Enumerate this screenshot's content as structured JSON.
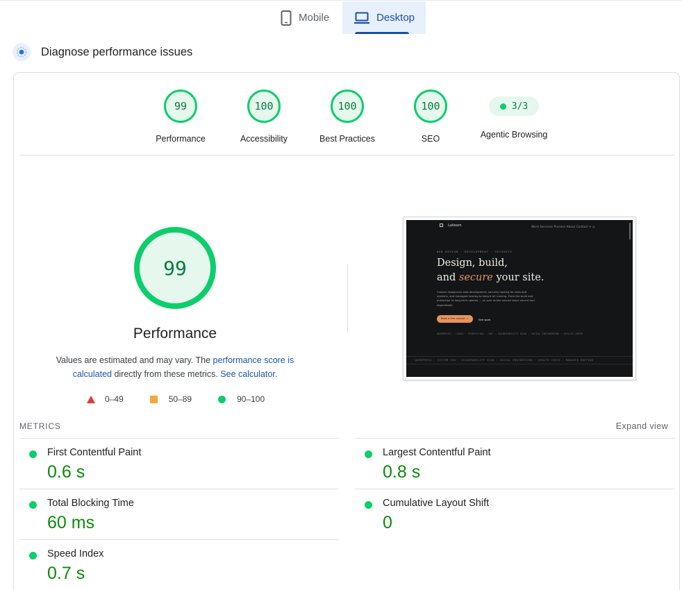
{
  "tabs": [
    {
      "label": "Mobile",
      "icon": "phone-icon",
      "selected": false
    },
    {
      "label": "Desktop",
      "icon": "laptop-icon",
      "selected": true
    }
  ],
  "section": {
    "title": "Diagnose performance issues",
    "icon": "diagnose-icon"
  },
  "categories": [
    {
      "score": "99",
      "label": "Performance"
    },
    {
      "score": "100",
      "label": "Accessibility"
    },
    {
      "score": "100",
      "label": "Best Practices"
    },
    {
      "score": "100",
      "label": "SEO"
    },
    {
      "score": "3/3",
      "label": "Agentic Browsing"
    }
  ],
  "performance": {
    "score": "99",
    "label": "Performance",
    "note_prefix": "Values are estimated and may vary. The ",
    "note_link1": "performance score is calculated",
    "note_middle": " directly from these metrics. ",
    "note_link2": "See calculator",
    "note_suffix": "."
  },
  "legend": [
    {
      "range": "0–49",
      "color": "#e53935",
      "shape": "triangle"
    },
    {
      "range": "50–89",
      "color": "#f4a93a",
      "shape": "square"
    },
    {
      "range": "90–100",
      "color": "#0cce6b",
      "shape": "circle"
    }
  ],
  "screenshot": {
    "brand": "Laileam",
    "nav": "Work   Services   Process   About   Contact   ✦   ◎",
    "eyebrow": "WEB DESIGN · DEVELOPMENT · SECURITY",
    "headline_line1": "Design, build,",
    "headline_and": "and ",
    "headline_accent": "secure",
    "headline_rest": " your site.",
    "body": "Custom responsive web development, security hosting for sites and systems, and managed hosting to keep it all running. From the build and protection to long-term upkeep — so your online service stays secure and dependable.",
    "cta": "Book a free consult  →",
    "secondary": "See work",
    "tags": "WORDPRESS  ·  LINUX  ·  PENTESTING  ·  WAF  ·  VULNERABILITY SCAN  ·  SOCIAL ENGINEERING  ·  HEALTH CHECK",
    "ticker": "·  WORDPRESS  ·  SYSTEM SEO  ·  VULNERABILITY SCAN  ·  SOCIAL ENGINEERING  ·  HEALTH CHECK  ·  MANAGED HOSTING"
  },
  "metrics": {
    "heading": "METRICS",
    "expand_label": "Expand view",
    "items": [
      {
        "name": "First Contentful Paint",
        "value": "0.6 s"
      },
      {
        "name": "Largest Contentful Paint",
        "value": "0.8 s"
      },
      {
        "name": "Total Blocking Time",
        "value": "60 ms"
      },
      {
        "name": "Cumulative Layout Shift",
        "value": "0"
      },
      {
        "name": "Speed Index",
        "value": "0.7 s"
      }
    ]
  },
  "colors": {
    "pass": "#0cce6b",
    "pass_text": "#0a8a0a",
    "average": "#f4a93a",
    "fail": "#e53935",
    "link": "#1a55b6",
    "tab_selected_bg": "#e8f0fe"
  }
}
